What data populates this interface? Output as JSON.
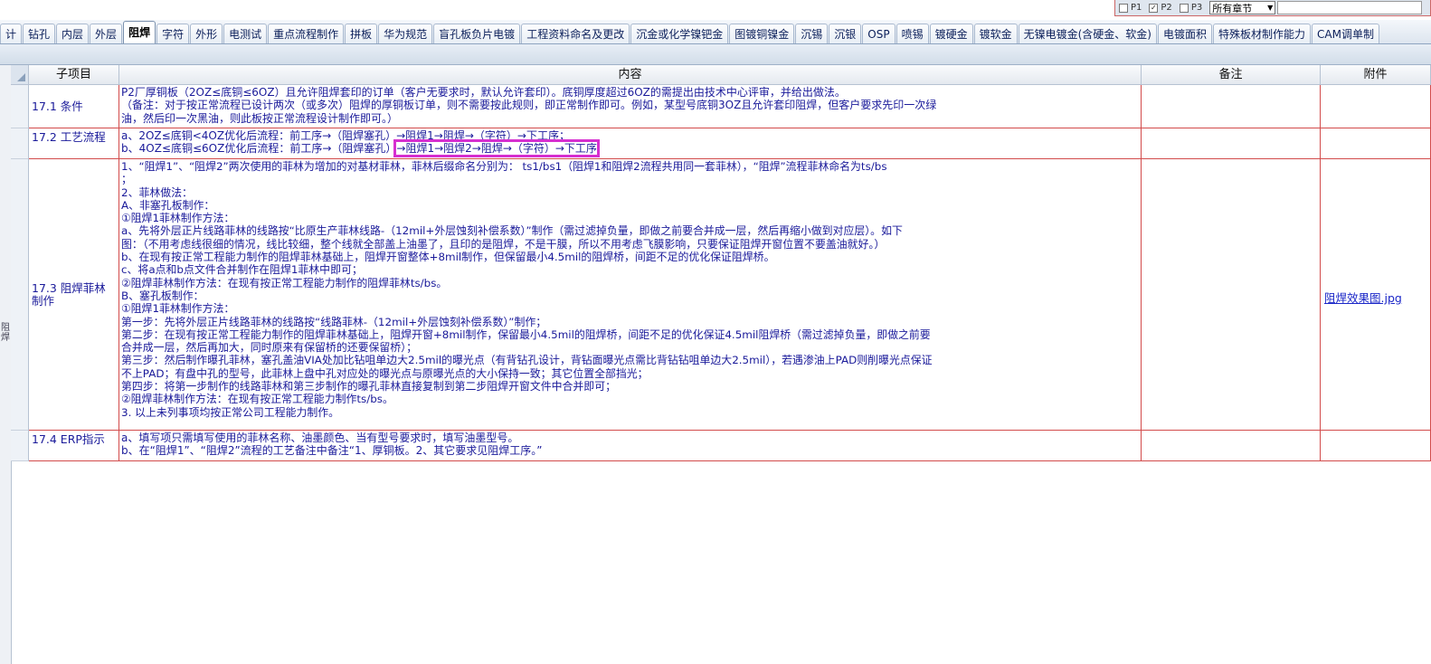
{
  "filter": {
    "p1": "P1",
    "p2": "P2",
    "p3": "P3",
    "p2_checked": "✓",
    "chapter_select": "所有章节"
  },
  "tabs": [
    "计",
    "钻孔",
    "内层",
    "外层",
    "阻焊",
    "字符",
    "外形",
    "电测试",
    "重点流程制作",
    "拼板",
    "华为规范",
    "盲孔板负片电镀",
    "工程资料命名及更改",
    "沉金或化学镍钯金",
    "图镀铜镍金",
    "沉锡",
    "沉银",
    "OSP",
    "喷锡",
    "镀硬金",
    "镀软金",
    "无镍电镀金(含硬金、软金)",
    "电镀面积",
    "特殊板材制作能力",
    "CAM调单制"
  ],
  "active_tab": "阻焊",
  "left_strip_text": "阻焊",
  "headers": {
    "sub": "子项目",
    "content": "内容",
    "remark": "备注",
    "attachment": "附件"
  },
  "rows": [
    {
      "sub": "17.1 条件",
      "lines": [
        "P2厂厚铜板（2OZ≤底铜≤6OZ）且允许阻焊套印的订单（客户无要求时，默认允许套印）。底铜厚度超过6OZ的需提出由技术中心评审，并给出做法。",
        "（备注：对于按正常流程已设计两次（或多次）阻焊的厚铜板订单，则不需要按此规则，即正常制作即可。例如，某型号底铜3OZ且允许套印阻焊，但客户要求先印一次绿",
        "油，然后印一次黑油，则此板按正常流程设计制作即可。）"
      ]
    },
    {
      "sub": "17.2 工艺流程",
      "line_a": "a、2OZ≤底铜<4OZ优化后流程：前工序→（阻焊塞孔）→阻焊1→阻焊→（字符）→下工序；",
      "line_b_pre": "b、4OZ≤底铜≤6OZ优化后流程：前工序→（阻焊塞孔）",
      "line_b_hl": "→阻焊1→阻焊2→阻焊→（字符）→下工序"
    },
    {
      "sub": "17.3 阻焊菲林制作",
      "lines": [
        "1、“阻焊1”、“阻焊2”两次使用的菲林为增加的对基材菲林，菲林后缀命名分别为： ts1/bs1（阻焊1和阻焊2流程共用同一套菲林），“阻焊”流程菲林命名为ts/bs",
        "；",
        "2、菲林做法：",
        "A、非塞孔板制作：",
        "①阻焊1菲林制作方法：",
        "a、先将外层正片线路菲林的线路按“比原生产菲林线路-（12mil+外层蚀刻补偿系数）”制作（需过滤掉负量，即做之前要合并成一层，然后再缩小做到对应层）。如下",
        "图：（不用考虑线很细的情况，线比较细，整个线就全部盖上油墨了，且印的是阻焊，不是干膜，所以不用考虑飞膜影响，只要保证阻焊开窗位置不要盖油就好。）",
        "b、在现有按正常工程能力制作的阻焊菲林基础上，阻焊开窗整体+8mil制作，但保留最小4.5mil的阻焊桥，间距不足的优化保证阻焊桥。",
        "c、将a点和b点文件合并制作在阻焊1菲林中即可；",
        "②阻焊菲林制作方法：在现有按正常工程能力制作的阻焊菲林ts/bs。",
        "B、塞孔板制作：",
        "①阻焊1菲林制作方法：",
        "第一步：先将外层正片线路菲林的线路按“线路菲林-（12mil+外层蚀刻补偿系数）”制作；",
        "第二步：在现有按正常工程能力制作的阻焊菲林基础上，阻焊开窗+8mil制作，保留最小4.5mil的阻焊桥，间距不足的优化保证4.5mil阻焊桥（需过滤掉负量，即做之前要",
        "合并成一层，然后再加大，同时原来有保留桥的还要保留桥）；",
        "第三步：然后制作曝孔菲林，塞孔盖油VIA处加比钻咀单边大2.5mil的曝光点（有背钻孔设计，背钻面曝光点需比背钻钻咀单边大2.5mil），若遇渗油上PAD则削曝光点保证",
        "不上PAD；有盘中孔的型号，此菲林上盘中孔对应处的曝光点与原曝光点的大小保持一致；其它位置全部挡光；",
        "第四步：将第一步制作的线路菲林和第三步制作的曝孔菲林直接复制到第二步阻焊开窗文件中合并即可；",
        "②阻焊菲林制作方法：在现有按正常工程能力制作ts/bs。",
        "3. 以上未列事项均按正常公司工程能力制作。"
      ],
      "attachment": "阻焊效果图.jpg"
    },
    {
      "sub": "17.4 ERP指示",
      "lines": [
        "a、填写项只需填写使用的菲林名称、油墨颜色、当有型号要求时，填写油墨型号。",
        "b、在“阻焊1”、“阻焊2”流程的工艺备注中备注“1、厚铜板。2、其它要求见阻焊工序。”"
      ]
    }
  ]
}
